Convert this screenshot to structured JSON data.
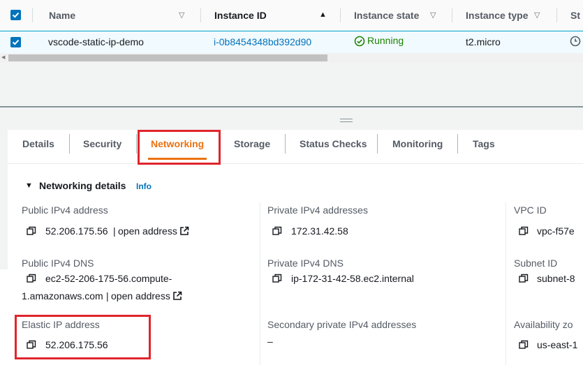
{
  "table": {
    "headers": {
      "name": "Name",
      "instance_id": "Instance ID",
      "instance_state": "Instance state",
      "instance_type": "Instance type",
      "status_check": "St"
    },
    "row": {
      "name": "vscode-static-ip-demo",
      "instance_id": "i-0b8454348bd392d90",
      "state": "Running",
      "type": "t2.micro"
    }
  },
  "tabs": [
    "Details",
    "Security",
    "Networking",
    "Storage",
    "Status Checks",
    "Monitoring",
    "Tags"
  ],
  "networking": {
    "section_title": "Networking details",
    "info": "Info",
    "public_ipv4_label": "Public IPv4 address",
    "public_ipv4": "52.206.175.56",
    "separator": "|",
    "open_address": "open address",
    "private_ipv4_label": "Private IPv4 addresses",
    "private_ipv4": "172.31.42.58",
    "vpc_label": "VPC ID",
    "vpc_id": "vpc-f57e",
    "public_dns_label": "Public IPv4 DNS",
    "public_dns_line1": "ec2-52-206-175-56.compute-",
    "public_dns_line2": "1.amazonaws.com",
    "private_dns_label": "Private IPv4 DNS",
    "private_dns": "ip-172-31-42-58.ec2.internal",
    "subnet_label": "Subnet ID",
    "subnet_id": "subnet-8",
    "elastic_ip_label": "Elastic IP address",
    "elastic_ip": "52.206.175.56",
    "secondary_label": "Secondary private IPv4 addresses",
    "secondary_value": "–",
    "az_label": "Availability zo",
    "az_value": "us-east-1"
  },
  "colors": {
    "accent": "#ec7211",
    "link": "#0073bb",
    "highlight_box": "#e0252b",
    "running": "#1d8102"
  }
}
